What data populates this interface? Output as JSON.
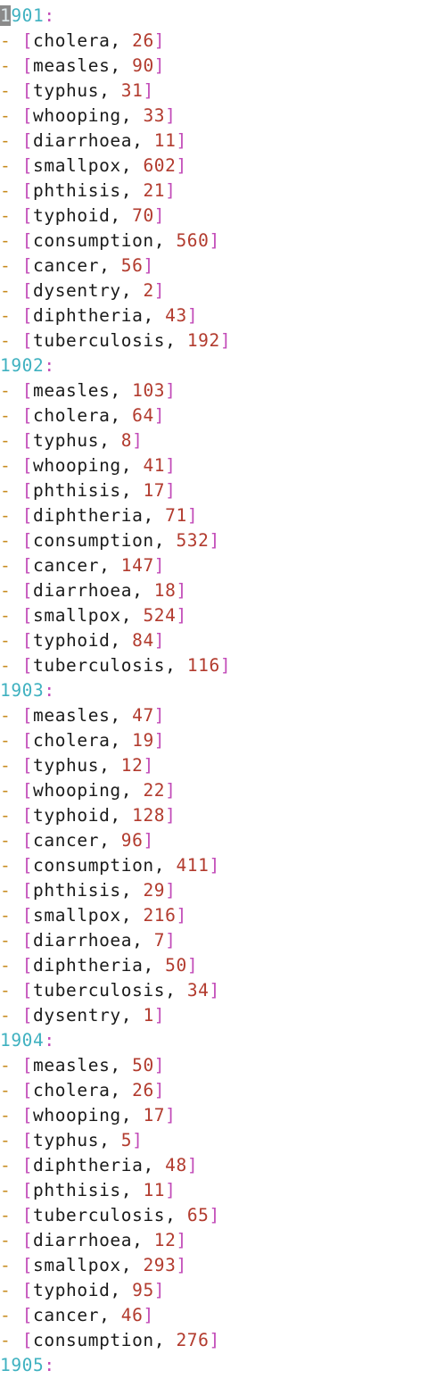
{
  "document": {
    "groups": [
      {
        "year": "1901",
        "items": [
          {
            "name": "cholera",
            "value": "26"
          },
          {
            "name": "measles",
            "value": "90"
          },
          {
            "name": "typhus",
            "value": "31"
          },
          {
            "name": "whooping",
            "value": "33"
          },
          {
            "name": "diarrhoea",
            "value": "11"
          },
          {
            "name": "smallpox",
            "value": "602"
          },
          {
            "name": "phthisis",
            "value": "21"
          },
          {
            "name": "typhoid",
            "value": "70"
          },
          {
            "name": "consumption",
            "value": "560"
          },
          {
            "name": "cancer",
            "value": "56"
          },
          {
            "name": "dysentry",
            "value": "2"
          },
          {
            "name": "diphtheria",
            "value": "43"
          },
          {
            "name": "tuberculosis",
            "value": "192"
          }
        ]
      },
      {
        "year": "1902",
        "items": [
          {
            "name": "measles",
            "value": "103"
          },
          {
            "name": "cholera",
            "value": "64"
          },
          {
            "name": "typhus",
            "value": "8"
          },
          {
            "name": "whooping",
            "value": "41"
          },
          {
            "name": "phthisis",
            "value": "17"
          },
          {
            "name": "diphtheria",
            "value": "71"
          },
          {
            "name": "consumption",
            "value": "532"
          },
          {
            "name": "cancer",
            "value": "147"
          },
          {
            "name": "diarrhoea",
            "value": "18"
          },
          {
            "name": "smallpox",
            "value": "524"
          },
          {
            "name": "typhoid",
            "value": "84"
          },
          {
            "name": "tuberculosis",
            "value": "116"
          }
        ]
      },
      {
        "year": "1903",
        "items": [
          {
            "name": "measles",
            "value": "47"
          },
          {
            "name": "cholera",
            "value": "19"
          },
          {
            "name": "typhus",
            "value": "12"
          },
          {
            "name": "whooping",
            "value": "22"
          },
          {
            "name": "typhoid",
            "value": "128"
          },
          {
            "name": "cancer",
            "value": "96"
          },
          {
            "name": "consumption",
            "value": "411"
          },
          {
            "name": "phthisis",
            "value": "29"
          },
          {
            "name": "smallpox",
            "value": "216"
          },
          {
            "name": "diarrhoea",
            "value": "7"
          },
          {
            "name": "diphtheria",
            "value": "50"
          },
          {
            "name": "tuberculosis",
            "value": "34"
          },
          {
            "name": "dysentry",
            "value": "1"
          }
        ]
      },
      {
        "year": "1904",
        "items": [
          {
            "name": "measles",
            "value": "50"
          },
          {
            "name": "cholera",
            "value": "26"
          },
          {
            "name": "whooping",
            "value": "17"
          },
          {
            "name": "typhus",
            "value": "5"
          },
          {
            "name": "diphtheria",
            "value": "48"
          },
          {
            "name": "phthisis",
            "value": "11"
          },
          {
            "name": "tuberculosis",
            "value": "65"
          },
          {
            "name": "diarrhoea",
            "value": "12"
          },
          {
            "name": "smallpox",
            "value": "293"
          },
          {
            "name": "typhoid",
            "value": "95"
          },
          {
            "name": "cancer",
            "value": "46"
          },
          {
            "name": "consumption",
            "value": "276"
          }
        ]
      },
      {
        "year": "1905",
        "items": []
      }
    ],
    "colors": {
      "year": "#3fb1c0",
      "punctuation": "#c24bb8",
      "dash": "#c78b1e",
      "number": "#b23b2e",
      "text": "#1a1a1a",
      "cursor": "#8a8a8a"
    }
  }
}
